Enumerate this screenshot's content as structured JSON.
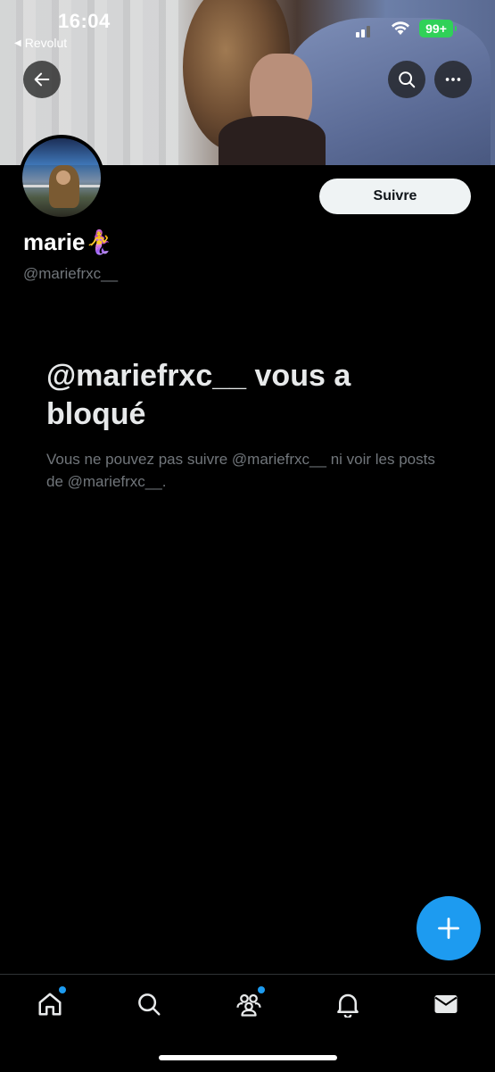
{
  "status_bar": {
    "time": "16:04",
    "back_app": "Revolut",
    "battery": "99+"
  },
  "profile": {
    "display_name": "marie🧜‍♀️",
    "handle": "@mariefrxc__",
    "follow_label": "Suivre"
  },
  "blocked": {
    "title": "@mariefrxc__ vous a bloqué",
    "description": "Vous ne pouvez pas suivre @mariefrxc__ ni voir les posts de @mariefrxc__."
  },
  "icons": {
    "back": "arrow-left-icon",
    "search": "search-icon",
    "more": "more-icon",
    "compose": "plus-icon",
    "tabs": [
      "home-icon",
      "search-icon",
      "communities-icon",
      "bell-icon",
      "mail-icon"
    ]
  },
  "colors": {
    "accent": "#1d9bf0",
    "background": "#000000",
    "battery": "#30d158",
    "secondary_text": "#71767b"
  }
}
